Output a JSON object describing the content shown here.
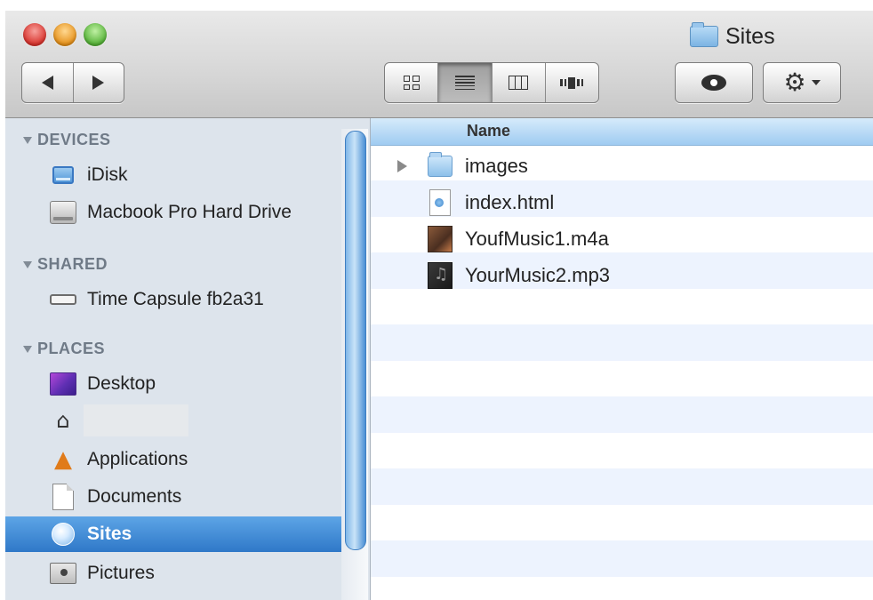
{
  "window": {
    "title": "Sites"
  },
  "sidebar": {
    "sections": [
      {
        "header": "DEVICES",
        "items": [
          {
            "label": "iDisk",
            "icon": "idisk-icon"
          },
          {
            "label": "Macbook Pro Hard Drive",
            "icon": "hard-drive-icon"
          }
        ]
      },
      {
        "header": "SHARED",
        "items": [
          {
            "label": "Time Capsule fb2a31",
            "icon": "time-capsule-icon"
          }
        ]
      },
      {
        "header": "PLACES",
        "items": [
          {
            "label": "Desktop",
            "icon": "desktop-icon"
          },
          {
            "label": "",
            "icon": "home-icon"
          },
          {
            "label": "Applications",
            "icon": "applications-icon"
          },
          {
            "label": "Documents",
            "icon": "documents-icon"
          },
          {
            "label": "Sites",
            "icon": "sites-icon",
            "selected": true
          },
          {
            "label": "Pictures",
            "icon": "pictures-icon"
          }
        ]
      }
    ]
  },
  "list": {
    "column_header": "Name",
    "rows": [
      {
        "name": "images",
        "icon": "folder-icon",
        "expandable": true
      },
      {
        "name": "index.html",
        "icon": "html-file-icon"
      },
      {
        "name": "YoufMusic1.m4a",
        "icon": "audio-file-icon"
      },
      {
        "name": "YourMusic2.mp3",
        "icon": "audio-file-icon"
      }
    ]
  },
  "toolbar": {
    "view_modes": [
      "icon-view",
      "list-view",
      "column-view",
      "cover-flow-view"
    ],
    "active_view": "list-view"
  },
  "colors": {
    "selection": "#3d87d2",
    "sidebar_bg": "#dde4ec",
    "stripe": "#edf3fe"
  }
}
